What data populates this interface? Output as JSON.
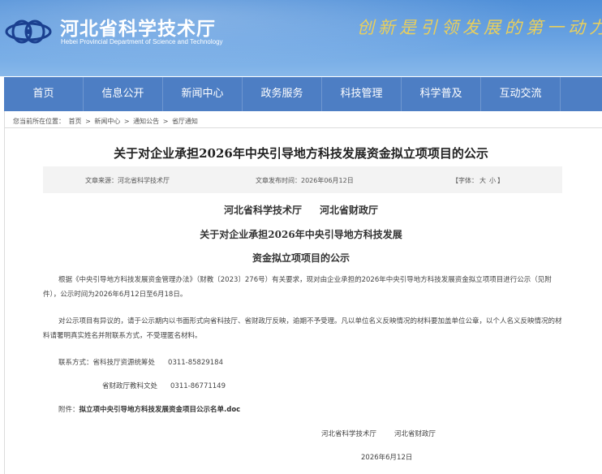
{
  "header": {
    "site_title": "河北省科学技术厅",
    "site_subtitle": "Hebei Provincial Department of Science and Technology",
    "slogan": "创新是引领发展的第一动力",
    "colors": {
      "header_bg": "#5b97dc",
      "slogan": "#e9cf5c",
      "nav_bg": "#4d7ec4"
    }
  },
  "nav": {
    "items": [
      {
        "label": "首页"
      },
      {
        "label": "信息公开"
      },
      {
        "label": "新闻中心"
      },
      {
        "label": "政务服务"
      },
      {
        "label": "科技管理"
      },
      {
        "label": "科学普及"
      },
      {
        "label": "互动交流"
      }
    ]
  },
  "breadcrumb": {
    "prefix": "您当前所在位置：",
    "items": [
      "首页",
      "新闻中心",
      "通知公告",
      "省厅通知"
    ],
    "separator": ">"
  },
  "article": {
    "title": "关于对企业承担2026年中央引导地方科技发展资金拟立项项目的公示",
    "source": "文章来源：河北省科学技术厅",
    "publish_date": "文章发布时间：2026年06月12日",
    "font_size_label": "【字体：",
    "font_large": "大",
    "font_small": "小",
    "font_size_end": "】",
    "org1": "河北省科学技术厅",
    "org2": "河北省财政厅",
    "heading_line1": "关于对企业承担2026年中央引导地方科技发展",
    "heading_line2": "资金拟立项项目的公示",
    "paragraph1": "根据《中央引导地方科技发展资金管理办法》（财教〔2023〕276号）有关要求，现对由企业承担的2026年中央引导地方科技发展资金拟立项项目进行公示（见附件），公示时间为2026年6月12日至6月18日。",
    "paragraph2": "对公示项目有异议的，请于公示期内以书面形式向省科技厅、省财政厅反映，逾期不予受理。凡以单位名义反映情况的材料要加盖单位公章，以个人名义反映情况的材料请署明真实姓名并附联系方式，不受理匿名材料。",
    "contact_label": "联系方式：",
    "contact1_unit": "省科技厅资源统筹处",
    "contact1_phone": "0311-85829184",
    "contact2_unit": "省财政厅教科文处",
    "contact2_phone": "0311-86771149",
    "attachment_label": "附件：",
    "attachment_link": "拟立项中央引导地方科技发展资金项目公示名单.doc",
    "sign_org1": "河北省科学技术厅",
    "sign_org2": "河北省财政厅",
    "sign_date": "2026年6月12日"
  }
}
